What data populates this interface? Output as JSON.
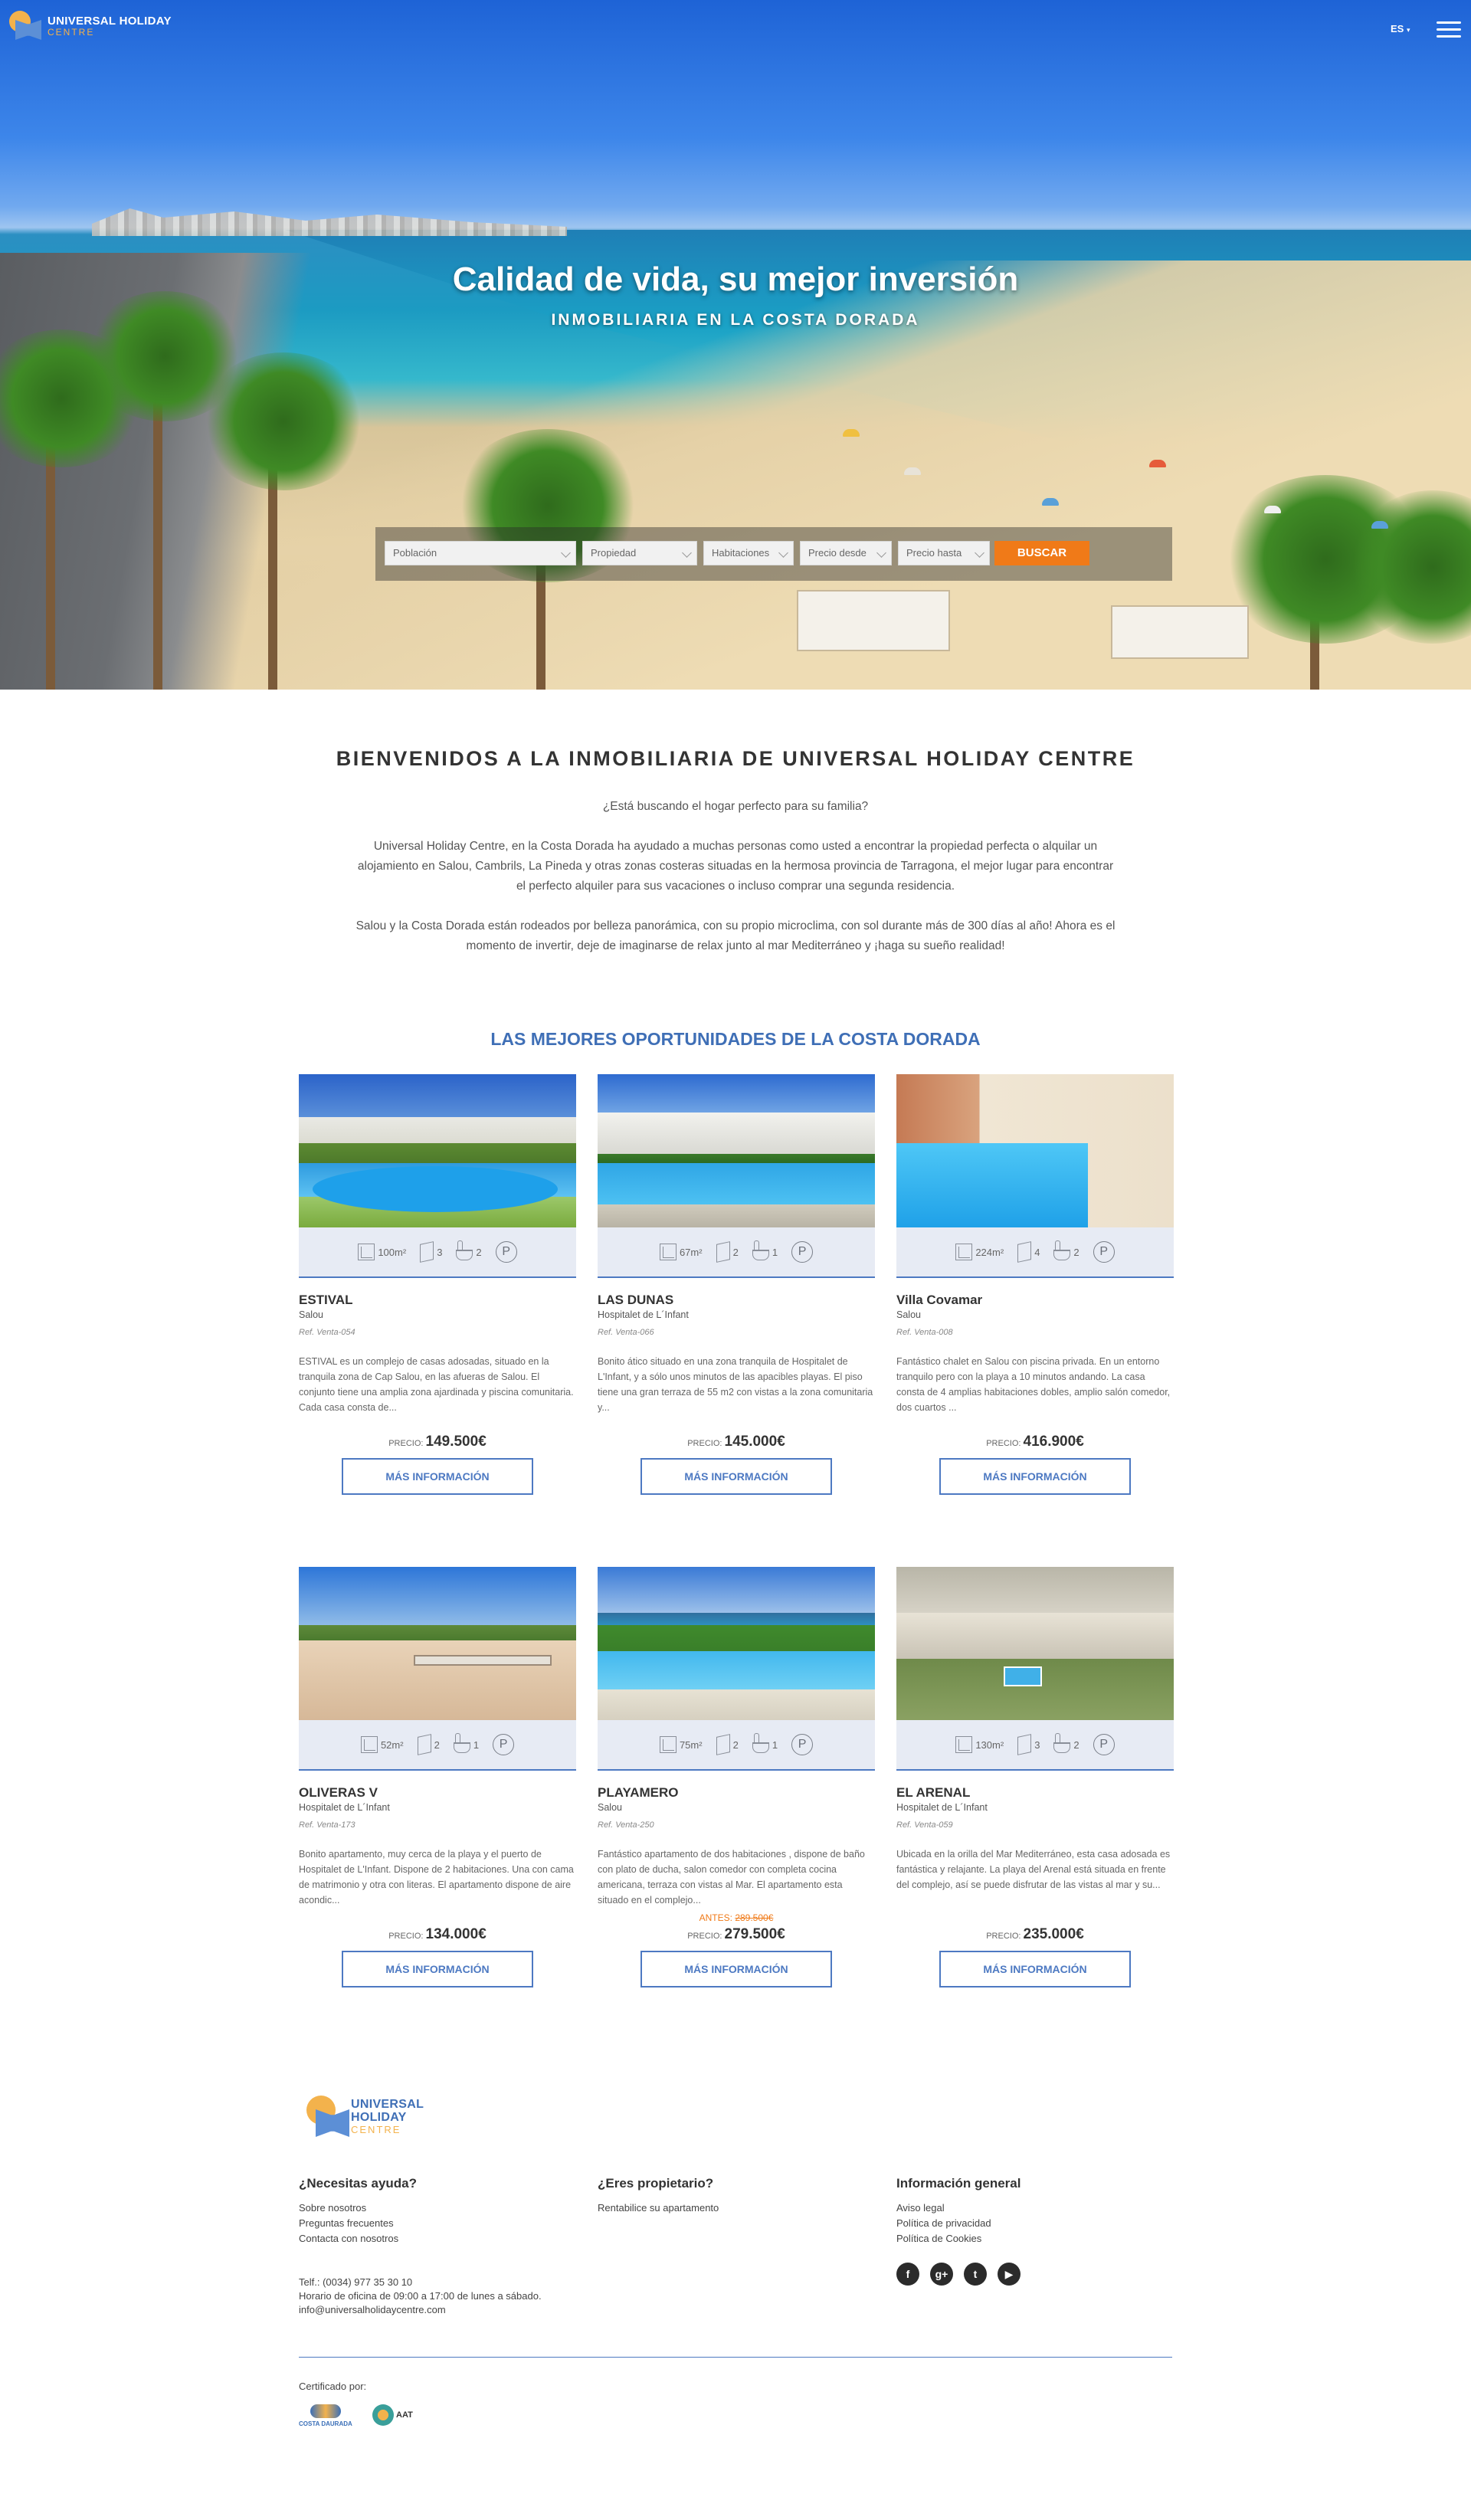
{
  "header": {
    "logo": {
      "line1": "UNIVERSAL HOLIDAY",
      "line2": "CENTRE"
    },
    "language": "ES"
  },
  "hero": {
    "title": "Calidad de vida, su mejor inversión",
    "subtitle": "INMOBILIARIA EN LA COSTA DORADA"
  },
  "search": {
    "poblacion": "Población",
    "propiedad": "Propiedad",
    "habitaciones": "Habitaciones",
    "precio_desde": "Precio desde",
    "precio_hasta": "Precio hasta",
    "button": "BUSCAR"
  },
  "welcome": {
    "title": "BIENVENIDOS A LA INMOBILIARIA DE UNIVERSAL HOLIDAY CENTRE",
    "question": "¿Está buscando el hogar perfecto para su familia?",
    "paragraph1": "Universal Holiday Centre, en la Costa Dorada ha ayudado a muchas personas como usted a encontrar la propiedad perfecta o alquilar un alojamiento en Salou, Cambrils, La Pineda y otras zonas costeras situadas en la hermosa provincia de Tarragona, el mejor lugar para encontrar el perfecto alquiler para sus vacaciones o incluso comprar una segunda residencia.",
    "paragraph2": "Salou y la Costa Dorada están rodeados por belleza panorámica, con su propio microclima, con sol durante más de 300 días al año! Ahora es el momento de invertir, deje de imaginarse de relax junto al mar Mediterráneo y ¡haga su sueño realidad!"
  },
  "listings_title": "LAS MEJORES OPORTUNIDADES DE LA COSTA DORADA",
  "listings": [
    {
      "name": "ESTIVAL",
      "location": "Salou",
      "ref": "Ref. Venta-054",
      "area": "100m²",
      "rooms": "3",
      "baths": "2",
      "description": "ESTIVAL es un complejo de casas adosadas, situado en la tranquila zona de Cap Salou, en las afueras de Salou. El conjunto tiene una amplia zona ajardinada y piscina comunitaria. Cada casa consta de...",
      "before_label": "",
      "before_price": "",
      "price_label": "PRECIO:",
      "price": "149.500€",
      "button": "MÁS INFORMACIÓN"
    },
    {
      "name": "LAS DUNAS",
      "location": "Hospitalet de L´Infant",
      "ref": "Ref. Venta-066",
      "area": "67m²",
      "rooms": "2",
      "baths": "1",
      "description": "Bonito ático situado en una zona tranquila de Hospitalet de L'Infant, y a sólo unos minutos de las apacibles playas. El piso tiene una gran terraza de 55 m2 con vistas a la zona comunitaria y...",
      "before_label": "",
      "before_price": "",
      "price_label": "PRECIO:",
      "price": "145.000€",
      "button": "MÁS INFORMACIÓN"
    },
    {
      "name": "Villa Covamar",
      "location": "Salou",
      "ref": "Ref. Venta-008",
      "area": "224m²",
      "rooms": "4",
      "baths": "2",
      "description": "Fantástico chalet en Salou con piscina privada. En un entorno tranquilo pero con la playa a 10 minutos andando. La casa consta de 4 amplias habitaciones dobles, amplio salón comedor, dos cuartos ...",
      "before_label": "",
      "before_price": "",
      "price_label": "PRECIO:",
      "price": "416.900€",
      "button": "MÁS INFORMACIÓN"
    },
    {
      "name": "OLIVERAS V",
      "location": "Hospitalet de L´Infant",
      "ref": "Ref. Venta-173",
      "area": "52m²",
      "rooms": "2",
      "baths": "1",
      "description": "Bonito apartamento, muy cerca de la playa y el puerto de Hospitalet de L'Infant. Dispone de 2 habitaciones. Una con cama de matrimonio y otra con literas. El apartamento dispone de aire acondic...",
      "before_label": "",
      "before_price": "",
      "price_label": "PRECIO:",
      "price": "134.000€",
      "button": "MÁS INFORMACIÓN"
    },
    {
      "name": "PLAYAMERO",
      "location": "Salou",
      "ref": "Ref. Venta-250",
      "area": "75m²",
      "rooms": "2",
      "baths": "1",
      "description": "Fantástico apartamento de dos habitaciones , dispone de baño con plato de ducha, salon comedor con completa cocina americana, terraza con vistas al Mar. El apartamento esta situado en el complejo...",
      "before_label": "ANTES:",
      "before_price": "289.500€",
      "price_label": "PRECIO:",
      "price": "279.500€",
      "button": "MÁS INFORMACIÓN"
    },
    {
      "name": "EL ARENAL",
      "location": "Hospitalet de L´Infant",
      "ref": "Ref. Venta-059",
      "area": "130m²",
      "rooms": "3",
      "baths": "2",
      "description": "Ubicada en la orilla del Mar Mediterráneo, esta casa adosada es fantástica y relajante. La playa del Arenal está situada en frente del complejo, así se puede disfrutar de las vistas al mar y su...",
      "before_label": "",
      "before_price": "",
      "price_label": "PRECIO:",
      "price": "235.000€",
      "button": "MÁS INFORMACIÓN"
    }
  ],
  "footer": {
    "logo": {
      "line1": "UNIVERSAL",
      "line2": "HOLIDAY",
      "line3": "CENTRE"
    },
    "help": {
      "title": "¿Necesitas ayuda?",
      "links": [
        "Sobre nosotros",
        "Preguntas frecuentes",
        "Contacta con nosotros"
      ]
    },
    "owner": {
      "title": "¿Eres propietario?",
      "links": [
        "Rentabilice su apartamento"
      ]
    },
    "info": {
      "title": "Información general",
      "links": [
        "Aviso legal",
        "Política de privacidad",
        "Política de Cookies"
      ]
    },
    "contact": {
      "phone": "Telf.: (0034) 977 35 30 10",
      "hours": "Horario de oficina de 09:00 a 17:00 de lunes a sábado.",
      "email": "info@universalholidaycentre.com"
    },
    "social": [
      "facebook-icon",
      "google-plus-icon",
      "twitter-icon",
      "youtube-icon"
    ],
    "certified_by": "Certificado por:",
    "cert1": "COSTA DAURADA",
    "cert2": "AAT"
  },
  "colors": {
    "accent": "#4d79c2",
    "orange": "#f07a18",
    "title": "#3f6fb6"
  }
}
